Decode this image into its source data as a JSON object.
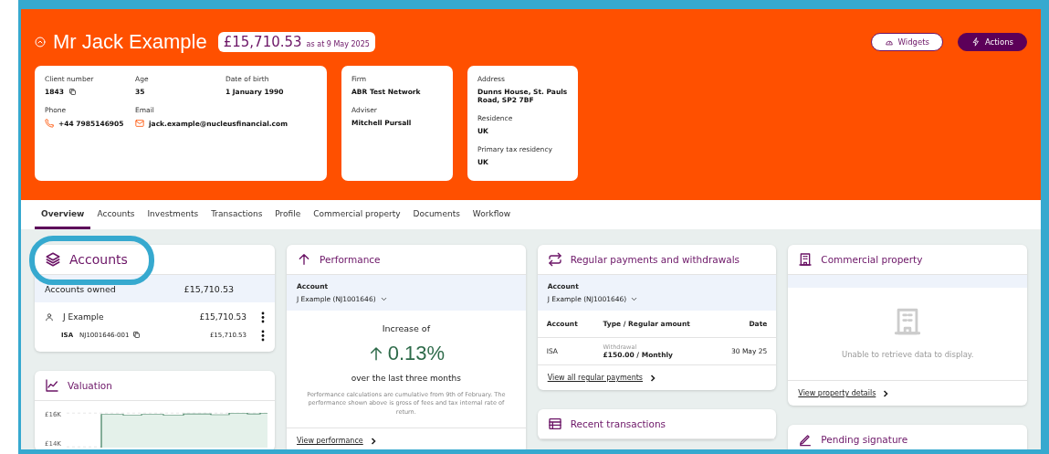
{
  "header": {
    "name": "Mr Jack Example",
    "balance": "£15,710.53",
    "as_at": "as at 9 May 2025",
    "buttons": [
      {
        "label": "Widgets",
        "kind": "outline"
      },
      {
        "label": "Actions",
        "kind": "primary"
      }
    ],
    "info_cards": [
      {
        "rows": [
          [
            {
              "label": "Client number",
              "value": "1843",
              "kind": "copy"
            },
            {
              "label": "Age",
              "value": "35"
            },
            {
              "label": "Date of birth",
              "value": "1 January 1990"
            }
          ],
          [
            {
              "label": "Phone",
              "value": "+44 7985146905",
              "kind": "phone"
            },
            {
              "label": "Email",
              "value": "jack.example@nucleusfinancial.com",
              "kind": "email"
            }
          ]
        ]
      },
      {
        "rows": [
          [
            {
              "label": "Firm",
              "value": "ABR Test Network"
            }
          ],
          [
            {
              "label": "Adviser",
              "value": "Mitchell Pursall"
            }
          ]
        ]
      },
      {
        "rows": [
          [
            {
              "label": "Address",
              "value": "Dunns House, St. Pauls Road, SP2 7BF"
            }
          ],
          [
            {
              "label": "Residence",
              "value": "UK"
            }
          ],
          [
            {
              "label": "Primary tax residency",
              "value": "UK"
            }
          ]
        ]
      }
    ]
  },
  "tabs": [
    {
      "label": "Overview",
      "selected": true
    },
    {
      "label": "Accounts",
      "selected": false
    },
    {
      "label": "Investments",
      "selected": false
    },
    {
      "label": "Transactions",
      "selected": false
    },
    {
      "label": "Profile",
      "selected": false
    },
    {
      "label": "Commercial property",
      "selected": false
    },
    {
      "label": "Documents",
      "selected": false
    },
    {
      "label": "Workflow",
      "selected": false
    }
  ],
  "columns": [
    [
      {
        "kind": "accounts",
        "title": "Accounts",
        "highlighted": true,
        "summary": {
          "label": "Accounts owned",
          "amount": "£15,710.53"
        },
        "holders": [
          {
            "name": "J Example",
            "amount": "£15,710.53",
            "accounts": [
              {
                "type": "ISA",
                "number": "NJ1001646-001",
                "amount": "£15,710.53"
              }
            ]
          }
        ]
      },
      {
        "kind": "valuation",
        "title": "Valuation",
        "y_labels": [
          "£16K",
          "£14K"
        ]
      }
    ],
    [
      {
        "kind": "performance",
        "title": "Performance",
        "selector_label": "Account",
        "selector_value": "J Example (NJ1001646)",
        "intro": "Increase of",
        "change": "0.13%",
        "period": "over the last three months",
        "note": "Performance calculations are cumulative from 9th of February. The performance shown above is gross of fees and tax internal rate of return.",
        "link": "View performance"
      }
    ],
    [
      {
        "kind": "regular_payments",
        "title": "Regular payments and withdrawals",
        "selector_label": "Account",
        "selector_value": "J Example (NJ1001646)",
        "table_columns": [
          "Account",
          "Type / Regular amount",
          "Date"
        ],
        "rows": [
          {
            "account": "ISA",
            "type": "Withdrawal",
            "amount": "£150.00 / Monthly",
            "date": "30 May 25"
          }
        ],
        "link": "View all regular payments"
      },
      {
        "kind": "recent_transactions",
        "title": "Recent transactions"
      }
    ],
    [
      {
        "kind": "commercial_property",
        "title": "Commercial property",
        "message": "Unable to retrieve data to display.",
        "link": "View property details"
      },
      {
        "kind": "pending_signature",
        "title": "Pending signature"
      }
    ]
  ]
}
